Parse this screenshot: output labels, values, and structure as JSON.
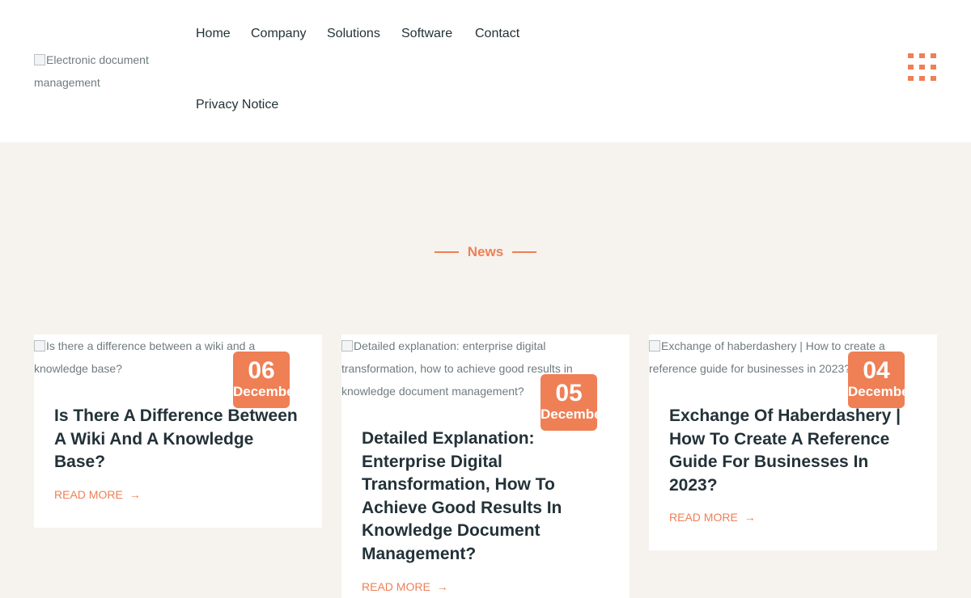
{
  "header": {
    "logo_alt": "Electronic document management",
    "nav": [
      "Home",
      "Company",
      "Solutions",
      "Software",
      "Contact",
      "Privacy Notice"
    ],
    "menu_icon": "grid-dots-icon"
  },
  "section": {
    "label": "News"
  },
  "posts": [
    {
      "image_alt": "Is there a difference between a wiki and a knowledge base?",
      "day": "06",
      "month": "December",
      "title": "Is There A Difference Between A Wiki And A Knowledge Base?",
      "read_more": "READ MORE"
    },
    {
      "image_alt": "Detailed explanation: enterprise digital transformation, how to achieve good results in knowledge document management?",
      "day": "05",
      "month": "December",
      "title": "Detailed Explanation: Enterprise Digital Transformation, How To Achieve Good Results In Knowledge Document Management?",
      "read_more": "READ MORE"
    },
    {
      "image_alt": "Exchange of haberdashery | How to create a reference guide for businesses in 2023?",
      "day": "04",
      "month": "December",
      "title": "Exchange Of Haberdashery | How To Create A Reference Guide For Businesses In 2023?",
      "read_more": "READ MORE"
    }
  ],
  "colors": {
    "accent": "#ef7f55",
    "background": "#f6f3ee",
    "text": "#233238"
  }
}
